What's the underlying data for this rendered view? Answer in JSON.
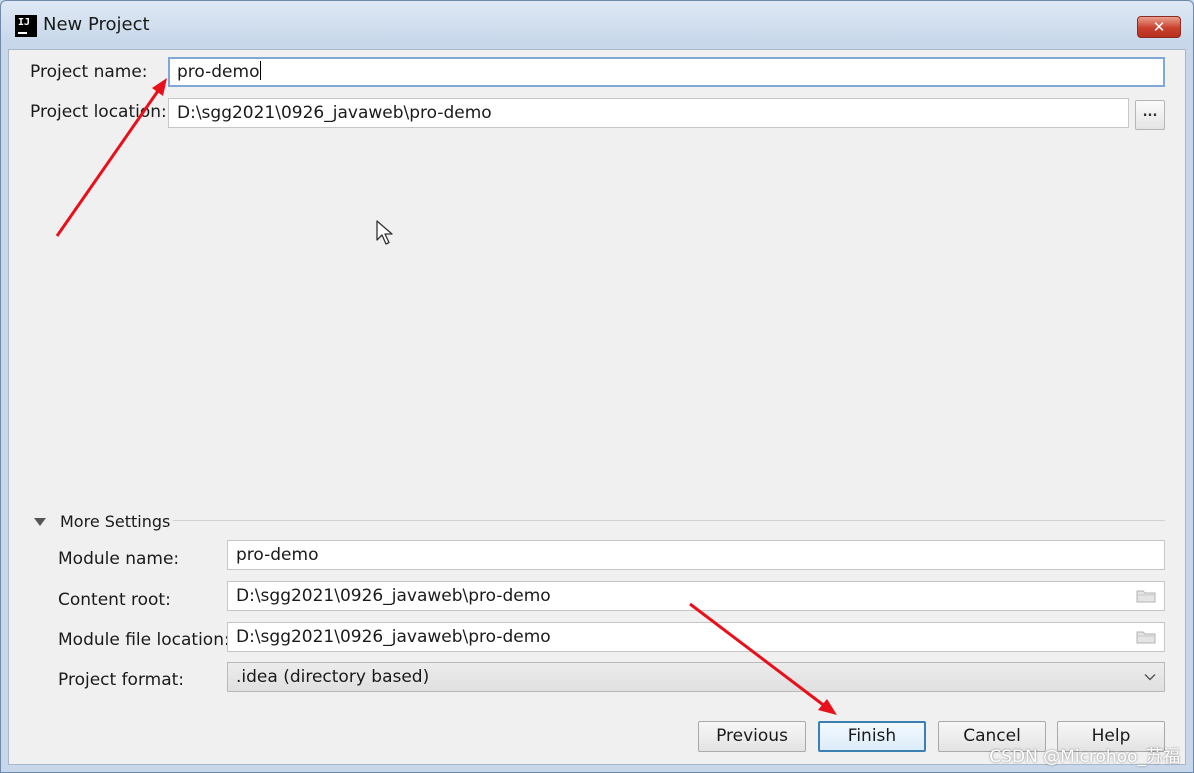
{
  "window": {
    "title": "New Project",
    "close_glyph": "✕",
    "app_icon_text": "IJ"
  },
  "project": {
    "name_label": "Project name:",
    "name_value": "pro-demo",
    "location_label": "Project location:",
    "location_value": "D:\\sgg2021\\0926_javaweb\\pro-demo",
    "browse_label": "..."
  },
  "more_settings": {
    "title": "More Settings",
    "module_name_label": "Module name:",
    "module_name_value": "pro-demo",
    "content_root_label": "Content root:",
    "content_root_value": "D:\\sgg2021\\0926_javaweb\\pro-demo",
    "module_file_label": "Module file location:",
    "module_file_value": "D:\\sgg2021\\0926_javaweb\\pro-demo",
    "format_label": "Project format:",
    "format_value": ".idea (directory based)"
  },
  "buttons": {
    "previous": "Previous",
    "finish": "Finish",
    "cancel": "Cancel",
    "help": "Help"
  },
  "icons": [
    "intellij-icon",
    "close-icon",
    "folder-icon",
    "triangle-down-icon",
    "chevron-down-icon",
    "mouse-cursor-icon"
  ],
  "colors": {
    "accent": "#3c7fb1",
    "annotation_arrow": "#e8101a",
    "close_button": "#c9412d"
  },
  "watermark": "CSDN @Microhoo_苏福"
}
